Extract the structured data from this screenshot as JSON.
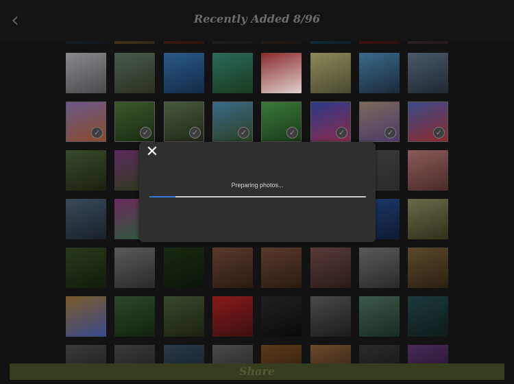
{
  "header": {
    "title": "Recently Added 8/96",
    "back_icon": "chevron-left-icon"
  },
  "share": {
    "label": "Share",
    "color": "#363d1e"
  },
  "dialog": {
    "message": "Preparing photos...",
    "progress": 0.12,
    "close_icon": "close-icon",
    "accent": "#2e7de0"
  },
  "grid": {
    "columns": 8,
    "rows": [
      {
        "thumbs": [
          {
            "c": [
              "#20303a",
              "#10151a"
            ]
          },
          {
            "c": [
              "#6a5a2a",
              "#302616"
            ]
          },
          {
            "c": [
              "#6a2a1a",
              "#2a1410"
            ]
          },
          {
            "c": [
              "#2a2a2a",
              "#181818"
            ]
          },
          {
            "c": [
              "#3a2a20",
              "#1a1410"
            ]
          },
          {
            "c": [
              "#1a4a5a",
              "#0f2028"
            ]
          },
          {
            "c": [
              "#6a1a1a",
              "#2a0f0f"
            ]
          },
          {
            "c": [
              "#4a3a3a",
              "#201a1a"
            ]
          }
        ]
      },
      {
        "thumbs": [
          {
            "c": [
              "#8a8a8c",
              "#4a4a4c"
            ]
          },
          {
            "c": [
              "#4a5a50",
              "#2a3020"
            ]
          },
          {
            "c": [
              "#2a5a8a",
              "#142a45"
            ]
          },
          {
            "c": [
              "#2a6a5a",
              "#1a3a20"
            ]
          },
          {
            "c": [
              "#8a2a2a",
              "#e0d0d0"
            ]
          },
          {
            "c": [
              "#8a8a5a",
              "#4a4a30"
            ]
          },
          {
            "c": [
              "#3a6a8a",
              "#1a2a3a"
            ]
          },
          {
            "c": [
              "#4a5a6a",
              "#20282e"
            ]
          }
        ]
      },
      {
        "thumbs": [
          {
            "c": [
              "#6a5a8a",
              "#8a4a2a"
            ]
          },
          {
            "c": [
              "#3a5a2a",
              "#1a2a12"
            ]
          },
          {
            "c": [
              "#4a5a3a",
              "#20281a"
            ]
          },
          {
            "c": [
              "#3a6a8a",
              "#2a4020"
            ]
          },
          {
            "c": [
              "#3a7a3a",
              "#1a3a1a"
            ]
          },
          {
            "c": [
              "#2a3a8a",
              "#8a2a4a"
            ]
          },
          {
            "c": [
              "#7a6a5a",
              "#4a3a6a"
            ]
          },
          {
            "c": [
              "#3a4a8a",
              "#8a2a2a"
            ]
          }
        ],
        "selected": true
      },
      {
        "thumbs": [
          {
            "c": [
              "#3a4a2a",
              "#1a2012"
            ]
          },
          {
            "c": [
              "#5a2a5a",
              "#2a3a1a"
            ]
          },
          {
            "c": [
              "#202020",
              "#101010"
            ]
          },
          {
            "c": [
              "#202020",
              "#101010"
            ]
          },
          {
            "c": [
              "#202020",
              "#101010"
            ]
          },
          {
            "c": [
              "#202020",
              "#101010"
            ]
          },
          {
            "c": [
              "#3a3a3a",
              "#2a2a2a"
            ]
          },
          {
            "c": [
              "#8a5a5a",
              "#4a2a2a"
            ]
          }
        ]
      },
      {
        "thumbs": [
          {
            "c": [
              "#3a4a5a",
              "#1a2028"
            ]
          },
          {
            "c": [
              "#6a2a5a",
              "#2a5a3a"
            ]
          },
          {
            "c": [
              "#202020",
              "#101010"
            ]
          },
          {
            "c": [
              "#202020",
              "#101010"
            ]
          },
          {
            "c": [
              "#202020",
              "#101010"
            ]
          },
          {
            "c": [
              "#202020",
              "#101010"
            ]
          },
          {
            "c": [
              "#1a3a6a",
              "#0f1a30"
            ]
          },
          {
            "c": [
              "#6a6a4a",
              "#30301a"
            ]
          }
        ]
      },
      {
        "thumbs": [
          {
            "c": [
              "#2a3a1a",
              "#121a0c"
            ]
          },
          {
            "c": [
              "#5a5a5a",
              "#2a2a2a"
            ]
          },
          {
            "c": [
              "#1a2a12",
              "#0c120a"
            ]
          },
          {
            "c": [
              "#5a3a2a",
              "#2a1a12"
            ]
          },
          {
            "c": [
              "#5a3a2a",
              "#2a1a12"
            ]
          },
          {
            "c": [
              "#5a3a3a",
              "#2a1a1a"
            ]
          },
          {
            "c": [
              "#5a5a5a",
              "#2a2a2a"
            ]
          },
          {
            "c": [
              "#5a4a2a",
              "#2a2012"
            ]
          }
        ]
      },
      {
        "thumbs": [
          {
            "c": [
              "#7a5a2a",
              "#3a4a8a"
            ]
          },
          {
            "c": [
              "#2a4a2a",
              "#12200f"
            ]
          },
          {
            "c": [
              "#3a4a2a",
              "#1a2012"
            ]
          },
          {
            "c": [
              "#8a1a1a",
              "#3a0f0f"
            ]
          },
          {
            "c": [
              "#202020",
              "#0a0a0a"
            ]
          },
          {
            "c": [
              "#4a4a4a",
              "#1a1a1a"
            ]
          },
          {
            "c": [
              "#3a5a4a",
              "#1a2a20"
            ]
          },
          {
            "c": [
              "#1a3a3a",
              "#0f1a1a"
            ]
          }
        ]
      },
      {
        "thumbs": [
          {
            "c": [
              "#3a3a3a",
              "#1a1a1a"
            ]
          },
          {
            "c": [
              "#3a3a3a",
              "#1a1a1a"
            ]
          },
          {
            "c": [
              "#2a3a4a",
              "#121a20"
            ]
          },
          {
            "c": [
              "#4a4a4a",
              "#202020"
            ]
          },
          {
            "c": [
              "#5a3a1a",
              "#2a1a0c"
            ]
          },
          {
            "c": [
              "#6a4a2a",
              "#2a1a12"
            ]
          },
          {
            "c": [
              "#2a2a2a",
              "#121212"
            ]
          },
          {
            "c": [
              "#4a2a5a",
              "#1a0f20"
            ]
          }
        ]
      }
    ]
  }
}
